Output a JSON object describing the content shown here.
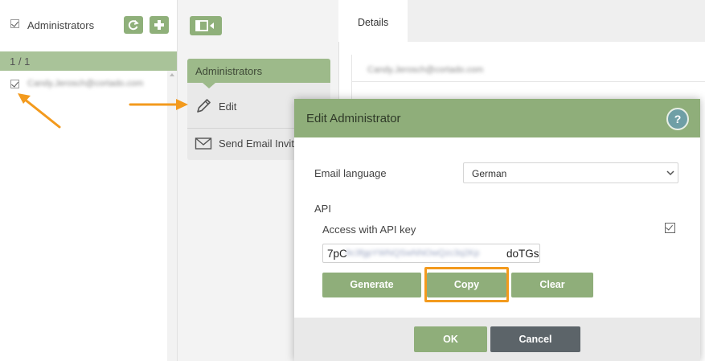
{
  "list_panel": {
    "title": "Administrators",
    "pager": "1 / 1",
    "rows": [
      {
        "email": "Candy.Jerosch@cortado.com"
      }
    ]
  },
  "actions_panel": {
    "heading": "Administrators",
    "items": [
      {
        "label": "Edit",
        "icon": "pencil-icon"
      },
      {
        "label": "Send Email Invit",
        "icon": "envelope-icon"
      }
    ]
  },
  "details_panel": {
    "tab": "Details",
    "email": "Candy.Jerosch@cortado.com"
  },
  "dialog": {
    "title": "Edit Administrator",
    "help_label": "?",
    "email_language_label": "Email language",
    "email_language_value": "German",
    "api_section_label": "API",
    "api_access_label": "Access with API key",
    "api_access_checked": true,
    "api_key_prefix": "7pC",
    "api_key_hidden": "9c3fgpYWNQSwNNOwQzc3q2Kp",
    "api_key_suffix": "doTGs",
    "buttons": {
      "generate": "Generate",
      "copy": "Copy",
      "clear": "Clear",
      "ok": "OK",
      "cancel": "Cancel"
    }
  },
  "colors": {
    "accent_green": "#8fae7a",
    "highlight_orange": "#f39a1d",
    "cancel_gray": "#5c6469"
  }
}
